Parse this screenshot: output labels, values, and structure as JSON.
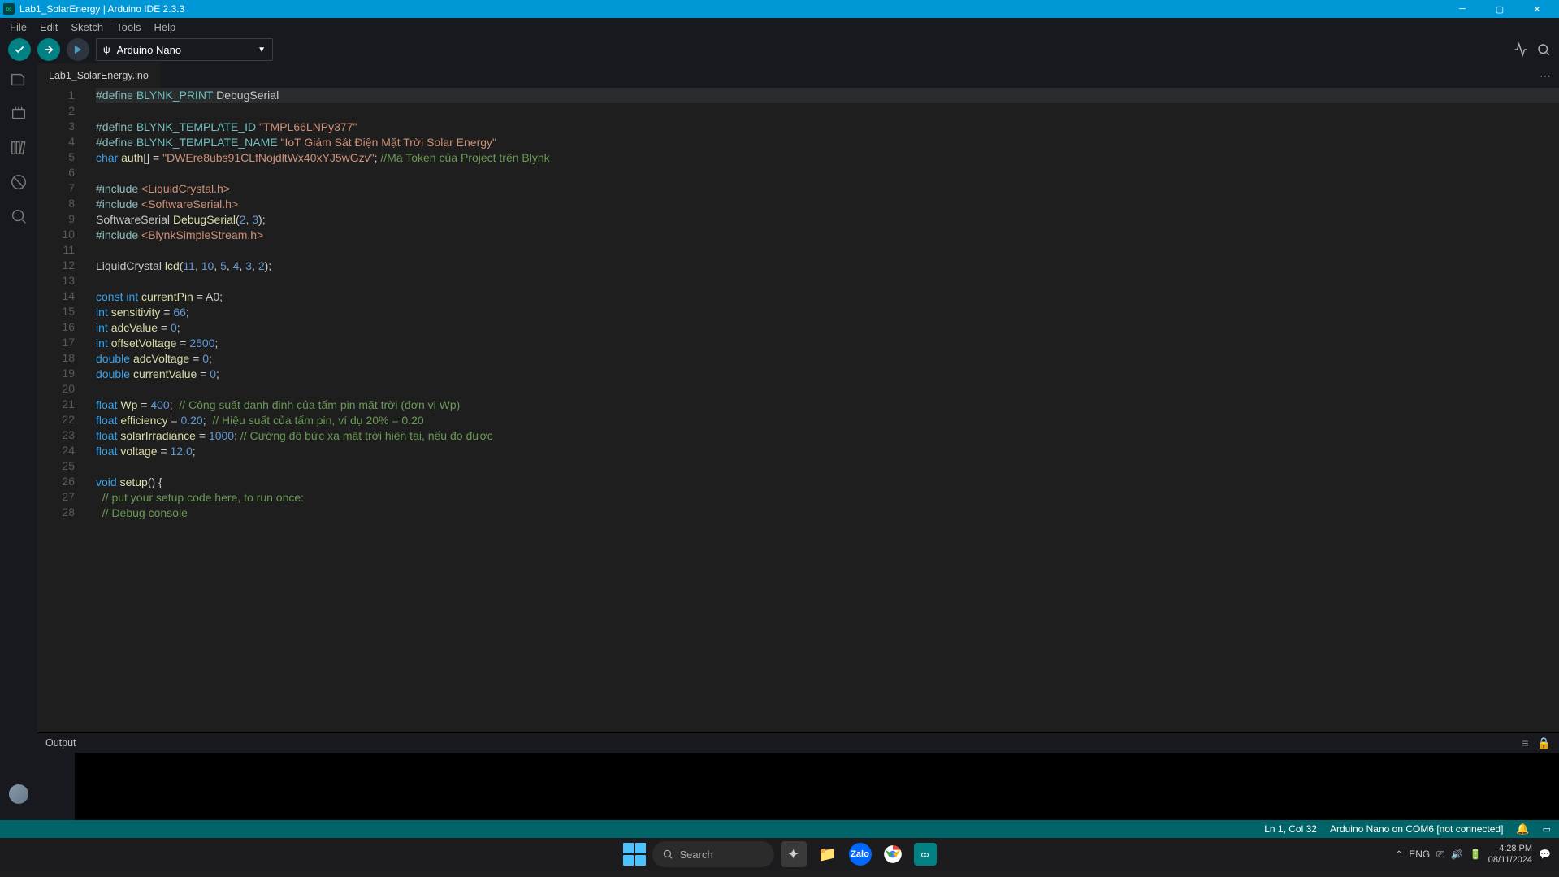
{
  "titlebar": {
    "text": "Lab1_SolarEnergy | Arduino IDE 2.3.3"
  },
  "menubar": {
    "items": [
      "File",
      "Edit",
      "Sketch",
      "Tools",
      "Help"
    ]
  },
  "board_select": {
    "name": "Arduino Nano"
  },
  "tab": {
    "name": "Lab1_SolarEnergy.ino"
  },
  "code": {
    "lines": [
      {
        "n": 1,
        "seg": [
          {
            "c": "kw-define",
            "t": "#define "
          },
          {
            "c": "kw-macro",
            "t": "BLYNK_PRINT "
          },
          {
            "c": "func",
            "t": "DebugSerial"
          }
        ],
        "hl": true
      },
      {
        "n": 2,
        "seg": []
      },
      {
        "n": 3,
        "seg": [
          {
            "c": "kw-define",
            "t": "#define "
          },
          {
            "c": "kw-macro",
            "t": "BLYNK_TEMPLATE_ID "
          },
          {
            "c": "str",
            "t": "\"TMPL66LNPy377\""
          }
        ]
      },
      {
        "n": 4,
        "seg": [
          {
            "c": "kw-define",
            "t": "#define "
          },
          {
            "c": "kw-macro",
            "t": "BLYNK_TEMPLATE_NAME "
          },
          {
            "c": "str",
            "t": "\"IoT Giám Sát Điện Mặt Trời Solar Energy\""
          }
        ]
      },
      {
        "n": 5,
        "seg": [
          {
            "c": "kw-type",
            "t": "char "
          },
          {
            "c": "ident",
            "t": "auth"
          },
          {
            "c": "punct",
            "t": "[] = "
          },
          {
            "c": "str",
            "t": "\"DWEre8ubs91CLfNojdltWx40xYJ5wGzv\""
          },
          {
            "c": "punct",
            "t": "; "
          },
          {
            "c": "cmt",
            "t": "//Mã Token của Project trên Blynk"
          }
        ]
      },
      {
        "n": 6,
        "seg": []
      },
      {
        "n": 7,
        "seg": [
          {
            "c": "kw-define",
            "t": "#include "
          },
          {
            "c": "str",
            "t": "<LiquidCrystal.h>"
          }
        ]
      },
      {
        "n": 8,
        "seg": [
          {
            "c": "kw-define",
            "t": "#include "
          },
          {
            "c": "str",
            "t": "<SoftwareSerial.h>"
          }
        ]
      },
      {
        "n": 9,
        "seg": [
          {
            "c": "func",
            "t": "SoftwareSerial "
          },
          {
            "c": "fname",
            "t": "DebugSerial"
          },
          {
            "c": "punct",
            "t": "("
          },
          {
            "c": "num",
            "t": "2"
          },
          {
            "c": "punct",
            "t": ", "
          },
          {
            "c": "num",
            "t": "3"
          },
          {
            "c": "punct",
            "t": ");"
          }
        ]
      },
      {
        "n": 10,
        "seg": [
          {
            "c": "kw-define",
            "t": "#include "
          },
          {
            "c": "str",
            "t": "<BlynkSimpleStream.h>"
          }
        ]
      },
      {
        "n": 11,
        "seg": []
      },
      {
        "n": 12,
        "seg": [
          {
            "c": "func",
            "t": "LiquidCrystal "
          },
          {
            "c": "fname",
            "t": "lcd"
          },
          {
            "c": "punct",
            "t": "("
          },
          {
            "c": "num",
            "t": "11"
          },
          {
            "c": "punct",
            "t": ", "
          },
          {
            "c": "num",
            "t": "10"
          },
          {
            "c": "punct",
            "t": ", "
          },
          {
            "c": "num",
            "t": "5"
          },
          {
            "c": "punct",
            "t": ", "
          },
          {
            "c": "num",
            "t": "4"
          },
          {
            "c": "punct",
            "t": ", "
          },
          {
            "c": "num",
            "t": "3"
          },
          {
            "c": "punct",
            "t": ", "
          },
          {
            "c": "num",
            "t": "2"
          },
          {
            "c": "punct",
            "t": ");"
          }
        ]
      },
      {
        "n": 13,
        "seg": []
      },
      {
        "n": 14,
        "seg": [
          {
            "c": "kw-type",
            "t": "const int "
          },
          {
            "c": "ident",
            "t": "currentPin"
          },
          {
            "c": "punct",
            "t": " = A0;"
          }
        ]
      },
      {
        "n": 15,
        "seg": [
          {
            "c": "kw-type",
            "t": "int "
          },
          {
            "c": "ident",
            "t": "sensitivity"
          },
          {
            "c": "punct",
            "t": " = "
          },
          {
            "c": "num",
            "t": "66"
          },
          {
            "c": "punct",
            "t": ";"
          }
        ]
      },
      {
        "n": 16,
        "seg": [
          {
            "c": "kw-type",
            "t": "int "
          },
          {
            "c": "ident",
            "t": "adcValue"
          },
          {
            "c": "punct",
            "t": " = "
          },
          {
            "c": "num",
            "t": "0"
          },
          {
            "c": "punct",
            "t": ";"
          }
        ]
      },
      {
        "n": 17,
        "seg": [
          {
            "c": "kw-type",
            "t": "int "
          },
          {
            "c": "ident",
            "t": "offsetVoltage"
          },
          {
            "c": "punct",
            "t": " = "
          },
          {
            "c": "num",
            "t": "2500"
          },
          {
            "c": "punct",
            "t": ";"
          }
        ]
      },
      {
        "n": 18,
        "seg": [
          {
            "c": "kw-type",
            "t": "double "
          },
          {
            "c": "ident",
            "t": "adcVoltage"
          },
          {
            "c": "punct",
            "t": " = "
          },
          {
            "c": "num",
            "t": "0"
          },
          {
            "c": "punct",
            "t": ";"
          }
        ]
      },
      {
        "n": 19,
        "seg": [
          {
            "c": "kw-type",
            "t": "double "
          },
          {
            "c": "ident",
            "t": "currentValue"
          },
          {
            "c": "punct",
            "t": " = "
          },
          {
            "c": "num",
            "t": "0"
          },
          {
            "c": "punct",
            "t": ";"
          }
        ]
      },
      {
        "n": 20,
        "seg": []
      },
      {
        "n": 21,
        "seg": [
          {
            "c": "kw-type",
            "t": "float "
          },
          {
            "c": "ident",
            "t": "Wp"
          },
          {
            "c": "punct",
            "t": " = "
          },
          {
            "c": "num",
            "t": "400"
          },
          {
            "c": "punct",
            "t": ";  "
          },
          {
            "c": "cmt",
            "t": "// Công suất danh định của tấm pin mặt trời (đơn vị Wp)"
          }
        ]
      },
      {
        "n": 22,
        "seg": [
          {
            "c": "kw-type",
            "t": "float "
          },
          {
            "c": "ident",
            "t": "efficiency"
          },
          {
            "c": "punct",
            "t": " = "
          },
          {
            "c": "num",
            "t": "0.20"
          },
          {
            "c": "punct",
            "t": ";  "
          },
          {
            "c": "cmt",
            "t": "// Hiệu suất của tấm pin, ví dụ 20% = 0.20"
          }
        ]
      },
      {
        "n": 23,
        "seg": [
          {
            "c": "kw-type",
            "t": "float "
          },
          {
            "c": "ident",
            "t": "solarIrradiance"
          },
          {
            "c": "punct",
            "t": " = "
          },
          {
            "c": "num",
            "t": "1000"
          },
          {
            "c": "punct",
            "t": "; "
          },
          {
            "c": "cmt",
            "t": "// Cường độ bức xạ mặt trời hiện tại, nếu đo được"
          }
        ]
      },
      {
        "n": 24,
        "seg": [
          {
            "c": "kw-type",
            "t": "float "
          },
          {
            "c": "ident",
            "t": "voltage"
          },
          {
            "c": "punct",
            "t": " = "
          },
          {
            "c": "num",
            "t": "12.0"
          },
          {
            "c": "punct",
            "t": ";"
          }
        ]
      },
      {
        "n": 25,
        "seg": []
      },
      {
        "n": 26,
        "seg": [
          {
            "c": "kw-type",
            "t": "void "
          },
          {
            "c": "fname",
            "t": "setup"
          },
          {
            "c": "punct",
            "t": "() {"
          }
        ]
      },
      {
        "n": 27,
        "seg": [
          {
            "c": "punct",
            "t": "  "
          },
          {
            "c": "cmt",
            "t": "// put your setup code here, to run once:"
          }
        ]
      },
      {
        "n": 28,
        "seg": [
          {
            "c": "punct",
            "t": "  "
          },
          {
            "c": "cmt",
            "t": "// Debug console"
          }
        ]
      }
    ]
  },
  "output": {
    "label": "Output"
  },
  "statusbar": {
    "position": "Ln 1, Col 32",
    "board_port": "Arduino Nano on COM6 [not connected]"
  },
  "taskbar": {
    "search_placeholder": "Search",
    "lang": "ENG",
    "time": "4:28 PM",
    "date": "08/11/2024"
  }
}
